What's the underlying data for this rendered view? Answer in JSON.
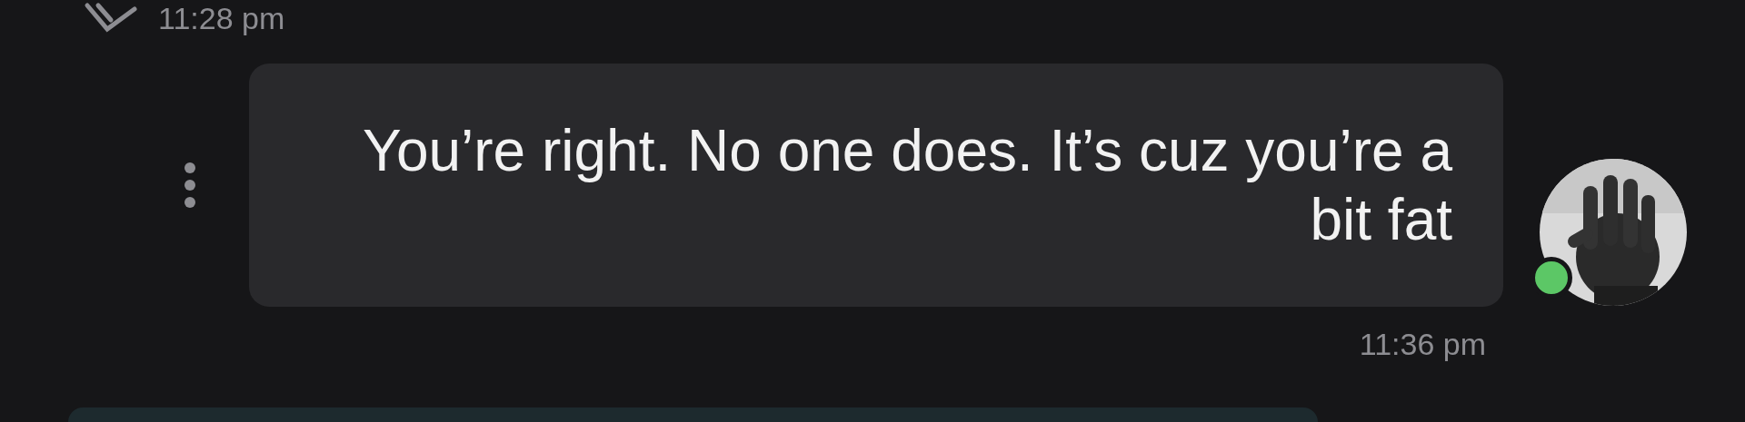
{
  "previous_message": {
    "time": "11:28 pm",
    "read": true
  },
  "message": {
    "text": "You’re right. No one does. It’s cuz you’re a bit fat",
    "time": "11:36 pm",
    "sender_online": true
  }
}
